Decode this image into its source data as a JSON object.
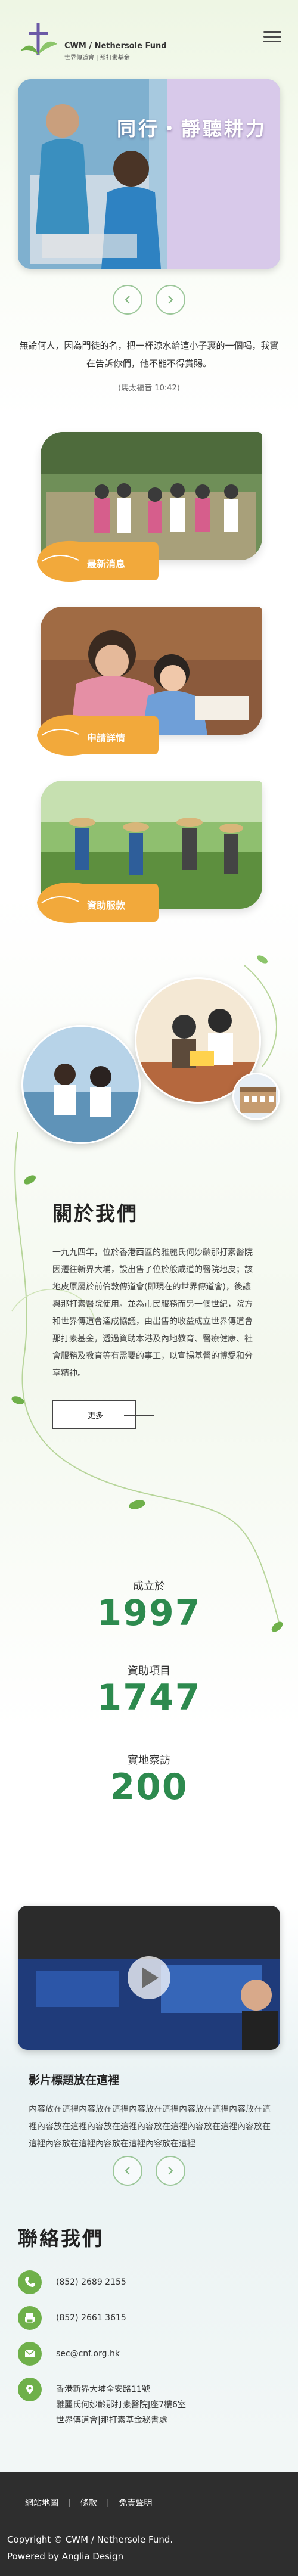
{
  "header": {
    "logo_en": "CWM / Nethersole Fund",
    "logo_zh": "世界傳道會 | 那打素基金",
    "menu_icon": "hamburger-menu-icon"
  },
  "hero": {
    "caption": "同行‧靜聽耕力",
    "prev_icon": "chevron-left-icon",
    "next_icon": "chevron-right-icon"
  },
  "verse": {
    "text": "無論何人，因為門徒的名，把一杯涼水給這小子裏的一個喝，我實在告訴你們，他不能不得賞賜。",
    "reference": "(馬太福音 10:42)"
  },
  "cards": [
    {
      "label": "最新消息"
    },
    {
      "label": "申請詳情"
    },
    {
      "label": "資助服款"
    }
  ],
  "about": {
    "title": "關於我們",
    "body": "一九九四年，位於香港西區的雅麗氏何妙齡那打素醫院因遷往新界大埔，設出售了位於般咸道的醫院地皮；該地皮原屬於前倫敦傳道會(即現在的世界傳道會)，後讓與那打素醫院使用。並為市民服務而另一個世紀，院方和世界傳道會達成協議，由出售的收益成立世界傳道會那打素基金，透過資助本港及內地教育、醫療健康、社會服務及教育等有需要的事工，以宣揚基督的博愛和分享精神。",
    "more_label": "更多"
  },
  "stats": [
    {
      "label": "成立於",
      "value": "1997"
    },
    {
      "label": "資助項目",
      "value": "1747"
    },
    {
      "label": "實地察訪",
      "value": "200"
    }
  ],
  "video": {
    "title": "影片標題放在這裡",
    "description": "內容放在這裡內容放在這裡內容放在這裡內容放在這裡內容放在這裡內容放在這裡內容放在這裡內容放在這裡內容放在這裡內容放在這裡內容放在這裡內容放在這裡內容放在這裡",
    "play_icon": "play-icon"
  },
  "contact": {
    "title": "聯絡我們",
    "phone": "(852) 2689 2155",
    "fax": "(852) 2661 3615",
    "email": "sec@cnf.org.hk",
    "address": "香港新界大埔全安路11號\n雅麗氏何妙齡那打素醫院J座7樓6室\n世界傳道會|那打素基金秘書處"
  },
  "footer": {
    "links": [
      "網站地圖",
      "條款",
      "免責聲明"
    ],
    "copyright": "Copyright © CWM / Nethersole Fund.",
    "powered": "Powered by Anglia Design"
  },
  "colors": {
    "accent_green": "#2d8a4e",
    "leaf_orange": "#f2a93b",
    "icon_green": "#6fb04a",
    "footer_bg": "#2e2e2e"
  }
}
